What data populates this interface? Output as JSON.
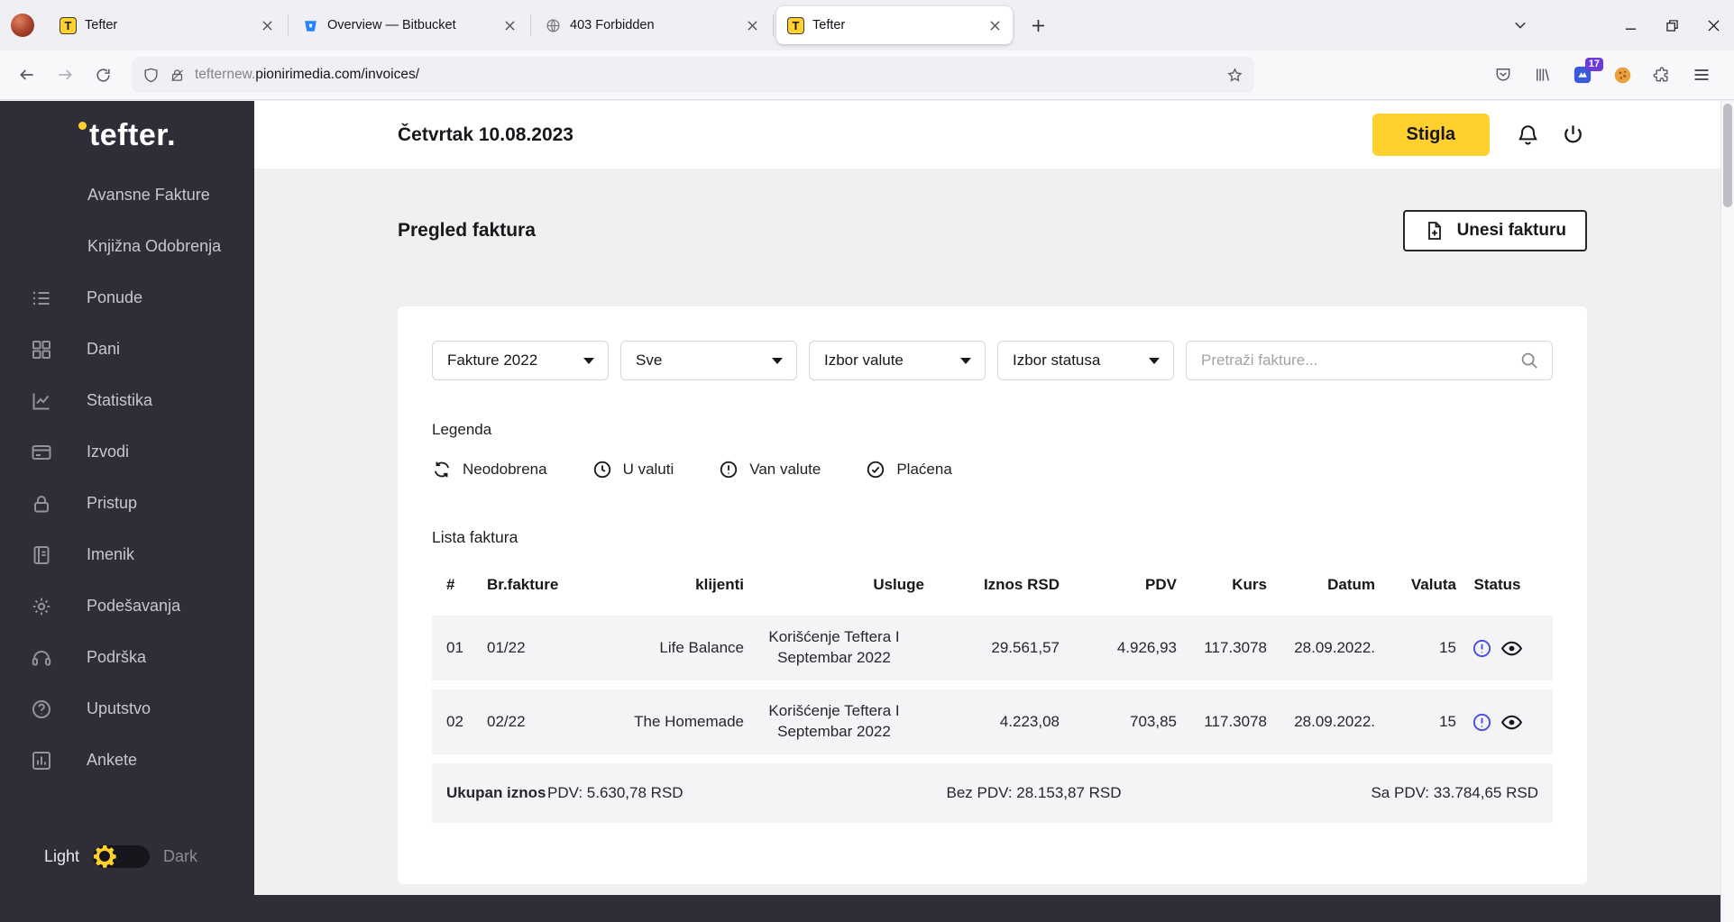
{
  "colors": {
    "accent_yellow": "#ffd02e",
    "sidebar_bg": "#2f2e38",
    "status_blue": "#4650e5"
  },
  "browser": {
    "tabs": [
      {
        "title": "Tefter",
        "favicon_letter": "T"
      },
      {
        "title": "Overview — Bitbucket"
      },
      {
        "title": "403 Forbidden"
      },
      {
        "title": "Tefter",
        "favicon_letter": "T"
      }
    ],
    "url": {
      "subdomain": "tefternew.",
      "domain": "pionirimedia.com",
      "path": "/invoices/"
    },
    "extension_badge": "17"
  },
  "sidebar": {
    "logo": "tefter.",
    "sub_items": [
      {
        "label": "Avansne Fakture"
      },
      {
        "label": "Knjižna Odobrenja"
      }
    ],
    "items": [
      {
        "label": "Ponude"
      },
      {
        "label": "Dani"
      },
      {
        "label": "Statistika"
      },
      {
        "label": "Izvodi"
      },
      {
        "label": "Pristup"
      },
      {
        "label": "Imenik"
      },
      {
        "label": "Podešavanja"
      },
      {
        "label": "Podrška"
      },
      {
        "label": "Uputstvo"
      },
      {
        "label": "Ankete"
      }
    ],
    "theme": {
      "light": "Light",
      "dark": "Dark"
    }
  },
  "header": {
    "date": "Četvrtak 10.08.2023",
    "status_button": "Stigla"
  },
  "page": {
    "title": "Pregled faktura",
    "add_button": "Unesi fakturu"
  },
  "filters": {
    "year": "Fakture 2022",
    "scope": "Sve",
    "currency": "Izbor valute",
    "status": "Izbor statusa",
    "search_placeholder": "Pretraži fakture..."
  },
  "legend": {
    "title": "Legenda",
    "items": [
      {
        "label": "Neodobrena"
      },
      {
        "label": "U valuti"
      },
      {
        "label": "Van valute"
      },
      {
        "label": "Plaćena"
      }
    ]
  },
  "invoice_table": {
    "title": "Lista faktura",
    "columns": [
      "#",
      "Br.fakture",
      "klijenti",
      "Usluge",
      "Iznos RSD",
      "PDV",
      "Kurs",
      "Datum",
      "Valuta",
      "Status"
    ],
    "rows": [
      {
        "num": "01",
        "invoice_no": "01/22",
        "client": "Life Balance",
        "service": "Korišćenje Teftera I Septembar 2022",
        "amount_rsd": "29.561,57",
        "pdv": "4.926,93",
        "kurs": "117.3078",
        "date": "28.09.2022.",
        "valuta": "15"
      },
      {
        "num": "02",
        "invoice_no": "02/22",
        "client": "The Homemade",
        "service": "Korišćenje Teftera I Septembar 2022",
        "amount_rsd": "4.223,08",
        "pdv": "703,85",
        "kurs": "117.3078",
        "date": "28.09.2022.",
        "valuta": "15"
      }
    ],
    "footer": {
      "label": "Ukupan iznos",
      "pdv_total": "PDV: 5.630,78 RSD",
      "without_pdv": "Bez PDV: 28.153,87 RSD",
      "with_pdv": "Sa PDV: 33.784,65 RSD"
    }
  }
}
